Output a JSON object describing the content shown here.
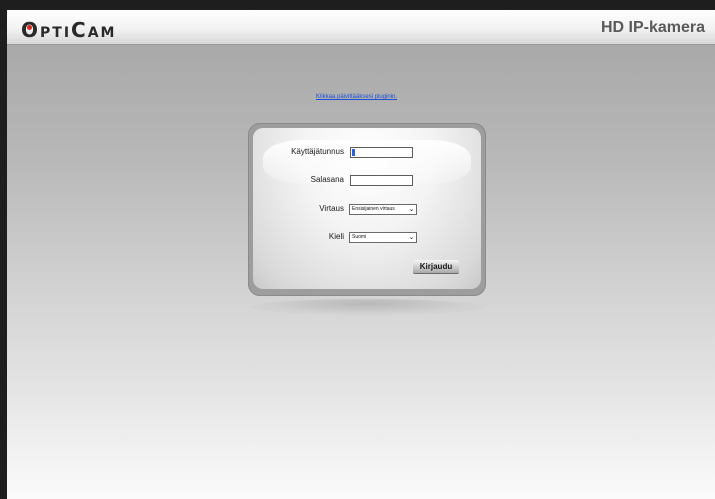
{
  "header": {
    "logo_text": "OptiCam",
    "title": "HD IP-kamera"
  },
  "plugin_link": "Klikkaa päivittääksesi pluginin.",
  "login": {
    "username_label": "Käyttäjätunnus",
    "password_label": "Salasana",
    "stream_label": "Virtaus",
    "stream_selected": "Ensisijainen virtaus",
    "language_label": "Kieli",
    "language_selected": "Suomi",
    "submit_label": "Kirjaudu"
  },
  "colors": {
    "frame": "#1e1e1e",
    "link": "#1c4fd6",
    "logo_dot": "#d42a1f",
    "caret": "#2f62d8"
  }
}
